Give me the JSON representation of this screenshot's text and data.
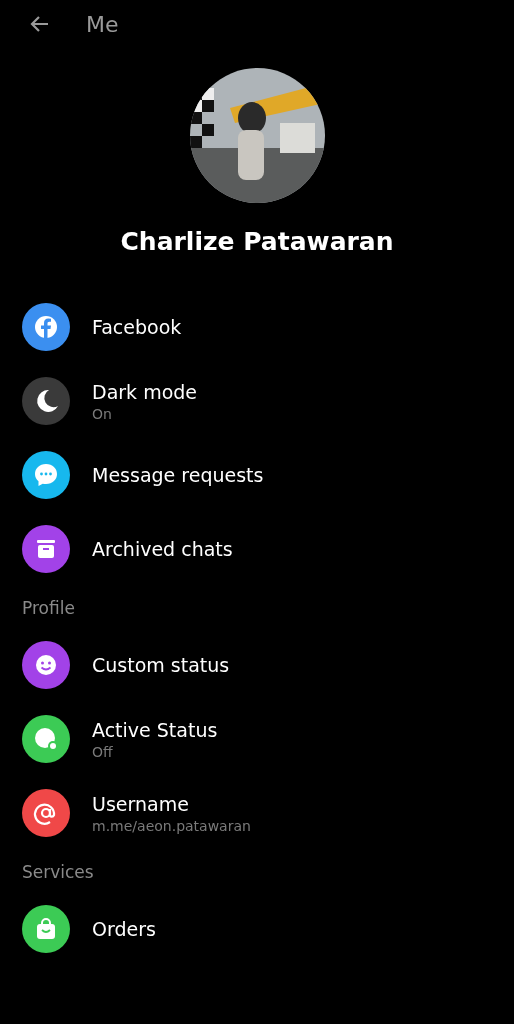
{
  "header": {
    "title": "Me"
  },
  "profile": {
    "name": "Charlize Patawaran"
  },
  "sections": [
    {
      "items": [
        {
          "label": "Facebook",
          "color": "#3b8ff0"
        },
        {
          "label": "Dark mode",
          "subtitle": "On",
          "color": "#3a3a3a"
        },
        {
          "label": "Message requests",
          "color": "#17b8ee"
        },
        {
          "label": "Archived chats",
          "color": "#a242e8"
        }
      ]
    },
    {
      "heading": "Profile",
      "items": [
        {
          "label": "Custom status",
          "color": "#a242e8"
        },
        {
          "label": "Active Status",
          "subtitle": "Off",
          "color": "#3ccb55"
        },
        {
          "label": "Username",
          "subtitle": "m.me/aeon.patawaran",
          "color": "#f04848"
        }
      ]
    },
    {
      "heading": "Services",
      "items": [
        {
          "label": "Orders",
          "color": "#3ccb55"
        }
      ]
    }
  ]
}
